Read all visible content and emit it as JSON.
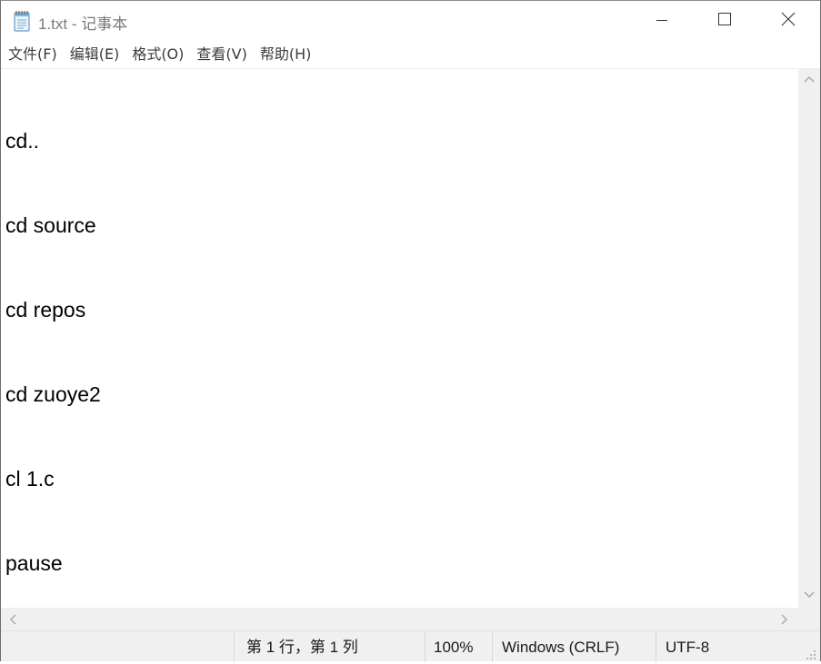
{
  "window": {
    "title": "1.txt - 记事本"
  },
  "menu": {
    "items": [
      {
        "label": "文件(F)"
      },
      {
        "label": "编辑(E)"
      },
      {
        "label": "格式(O)"
      },
      {
        "label": "查看(V)"
      },
      {
        "label": "帮助(H)"
      }
    ]
  },
  "editor": {
    "lines": [
      "cd..",
      "cd source",
      "cd repos",
      "cd zuoye2",
      "cl 1.c",
      "pause"
    ]
  },
  "status": {
    "position": "第 1 行，第 1 列",
    "zoom": "100%",
    "line_ending": "Windows (CRLF)",
    "encoding": "UTF-8"
  },
  "icons": {
    "app": "notepad-icon",
    "minimize": "minimize-icon",
    "maximize": "maximize-icon",
    "close": "close-icon"
  }
}
